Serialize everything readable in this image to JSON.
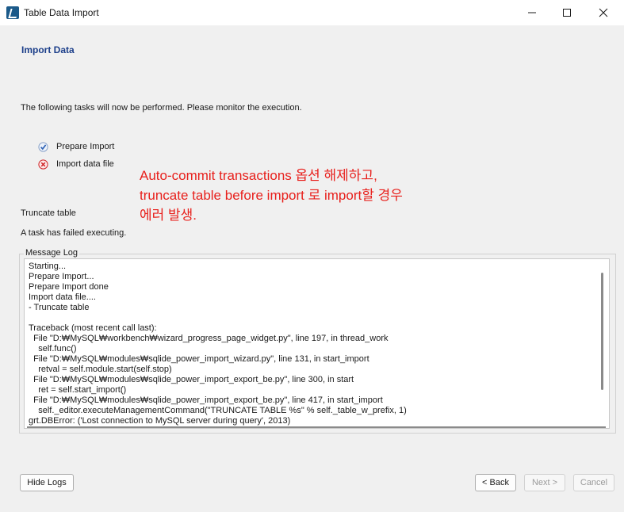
{
  "window": {
    "title": "Table Data Import"
  },
  "page": {
    "title": "Import Data",
    "description": "The following tasks will now be performed. Please monitor the execution."
  },
  "tasks": [
    {
      "label": "Prepare Import",
      "status": "done"
    },
    {
      "label": "Import data file",
      "status": "failed"
    }
  ],
  "annotation": {
    "line1": "Auto-commit transactions 옵션 해제하고,",
    "line2": "truncate table before import 로 import할 경우",
    "line3": "에러 발생."
  },
  "current_task": "Truncate table",
  "status_message": "A task has failed executing.",
  "message_log": {
    "label": "Message Log",
    "text": "Starting...\nPrepare Import...\nPrepare Import done\nImport data file....\n- Truncate table\n\nTraceback (most recent call last):\n  File \"D:₩MySQL₩workbench₩wizard_progress_page_widget.py\", line 197, in thread_work\n    self.func()\n  File \"D:₩MySQL₩modules₩sqlide_power_import_wizard.py\", line 131, in start_import\n    retval = self.module.start(self.stop)\n  File \"D:₩MySQL₩modules₩sqlide_power_import_export_be.py\", line 300, in start\n    ret = self.start_import()\n  File \"D:₩MySQL₩modules₩sqlide_power_import_export_be.py\", line 417, in start_import\n    self._editor.executeManagementCommand(\"TRUNCATE TABLE %s\" % self._table_w_prefix, 1)\ngrt.DBError: ('Lost connection to MySQL server during query', 2013)"
  },
  "buttons": {
    "hide_logs": "Hide Logs",
    "back": "< Back",
    "next": "Next >",
    "cancel": "Cancel"
  },
  "colors": {
    "section_title": "#1c3f8a",
    "annotation": "#e8201c",
    "done_icon": "#2f62b5",
    "failed_icon": "#d0282b"
  }
}
